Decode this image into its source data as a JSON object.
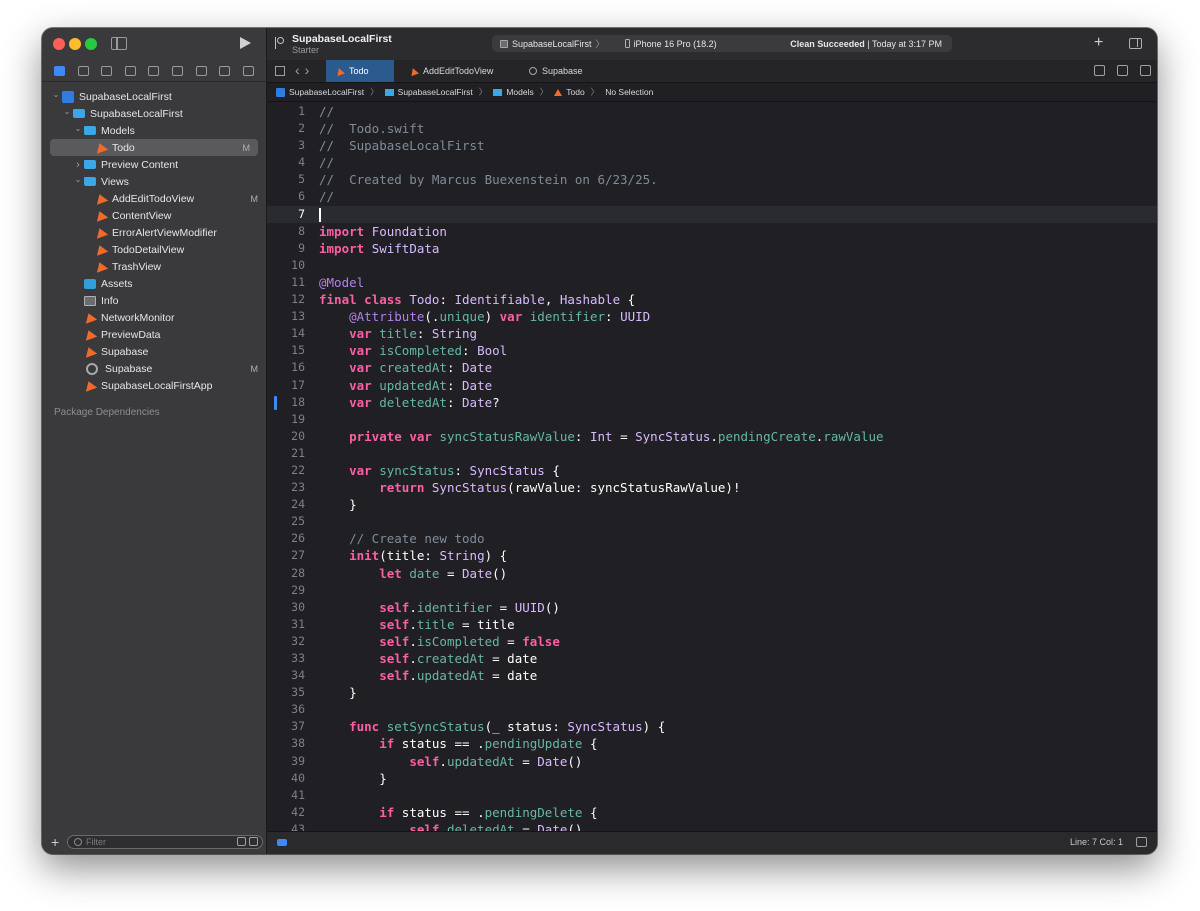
{
  "window": {
    "project_title": "SupabaseLocalFirst",
    "branch": "Starter",
    "scheme": "SupabaseLocalFirst",
    "device": "iPhone 16 Pro (18.2)",
    "status": "Clean Succeeded",
    "status_time": "| Today at 3:17 PM"
  },
  "sidebar": {
    "tree": [
      {
        "label": "SupabaseLocalFirst",
        "icon": "project-icon",
        "depth": 0,
        "disclosure": "open",
        "badge": ""
      },
      {
        "label": "SupabaseLocalFirst",
        "icon": "folder-icon",
        "depth": 1,
        "disclosure": "open",
        "badge": ""
      },
      {
        "label": "Models",
        "icon": "folder-icon",
        "depth": 2,
        "disclosure": "open",
        "badge": ""
      },
      {
        "label": "Todo",
        "icon": "swift-icon",
        "depth": 3,
        "disclosure": "",
        "badge": "M",
        "selected": true
      },
      {
        "label": "Preview Content",
        "icon": "folder-icon",
        "depth": 2,
        "disclosure": "closed",
        "badge": ""
      },
      {
        "label": "Views",
        "icon": "folder-icon",
        "depth": 2,
        "disclosure": "open",
        "badge": ""
      },
      {
        "label": "AddEditTodoView",
        "icon": "swift-icon",
        "depth": 3,
        "disclosure": "",
        "badge": "M"
      },
      {
        "label": "ContentView",
        "icon": "swift-icon",
        "depth": 3,
        "disclosure": "",
        "badge": ""
      },
      {
        "label": "ErrorAlertViewModifier",
        "icon": "swift-icon",
        "depth": 3,
        "disclosure": "",
        "badge": ""
      },
      {
        "label": "TodoDetailView",
        "icon": "swift-icon",
        "depth": 3,
        "disclosure": "",
        "badge": ""
      },
      {
        "label": "TrashView",
        "icon": "swift-icon",
        "depth": 3,
        "disclosure": "",
        "badge": ""
      },
      {
        "label": "Assets",
        "icon": "asset-catalog-icon",
        "depth": 2,
        "disclosure": "",
        "badge": ""
      },
      {
        "label": "Info",
        "icon": "plist-icon",
        "depth": 2,
        "disclosure": "",
        "badge": ""
      },
      {
        "label": "NetworkMonitor",
        "icon": "swift-icon",
        "depth": 2,
        "disclosure": "",
        "badge": ""
      },
      {
        "label": "PreviewData",
        "icon": "swift-icon",
        "depth": 2,
        "disclosure": "",
        "badge": ""
      },
      {
        "label": "Supabase",
        "icon": "swift-icon",
        "depth": 2,
        "disclosure": "",
        "badge": ""
      },
      {
        "label": "Supabase",
        "icon": "gear-icon",
        "depth": 2,
        "disclosure": "",
        "badge": "M"
      },
      {
        "label": "SupabaseLocalFirstApp",
        "icon": "swift-icon",
        "depth": 2,
        "disclosure": "",
        "badge": ""
      }
    ],
    "section_header": "Package Dependencies",
    "filter_placeholder": "Filter"
  },
  "tabs": [
    {
      "label": "Todo",
      "icon": "swift-icon",
      "active": true
    },
    {
      "label": "AddEditTodoView",
      "icon": "swift-icon",
      "active": false
    },
    {
      "label": "Supabase",
      "icon": "gear-icon",
      "active": false
    }
  ],
  "breadcrumb": [
    "SupabaseLocalFirst",
    "SupabaseLocalFirst",
    "Models",
    "Todo",
    "No Selection"
  ],
  "editor": {
    "current_line": 7,
    "lines": [
      "//",
      "//  Todo.swift",
      "//  SupabaseLocalFirst",
      "//",
      "//  Created by Marcus Buexenstein on 6/23/25.",
      "//",
      "",
      "import Foundation",
      "import SwiftData",
      "",
      "@Model",
      "final class Todo: Identifiable, Hashable {",
      "    @Attribute(.unique) var identifier: UUID",
      "    var title: String",
      "    var isCompleted: Bool",
      "    var createdAt: Date",
      "    var updatedAt: Date",
      "    var deletedAt: Date?",
      "",
      "    private var syncStatusRawValue: Int = SyncStatus.pendingCreate.rawValue",
      "",
      "    var syncStatus: SyncStatus {",
      "        return SyncStatus(rawValue: syncStatusRawValue)!",
      "    }",
      "",
      "    // Create new todo",
      "    init(title: String) {",
      "        let date = Date()",
      "",
      "        self.identifier = UUID()",
      "        self.title = title",
      "        self.isCompleted = false",
      "        self.createdAt = date",
      "        self.updatedAt = date",
      "    }",
      "",
      "    func setSyncStatus(_ status: SyncStatus) {",
      "        if status == .pendingUpdate {",
      "            self.updatedAt = Date()",
      "        }",
      "",
      "        if status == .pendingDelete {",
      "            self.deletedAt = Date()"
    ]
  },
  "statusbar": {
    "position": "Line: 7  Col: 1"
  },
  "colors": {
    "keyword": "#fc5fa3",
    "comment": "#7f8c98",
    "accent": "#3d8af7",
    "swift_icon": "#f06a2b",
    "folder_icon": "#3aa8e8"
  }
}
